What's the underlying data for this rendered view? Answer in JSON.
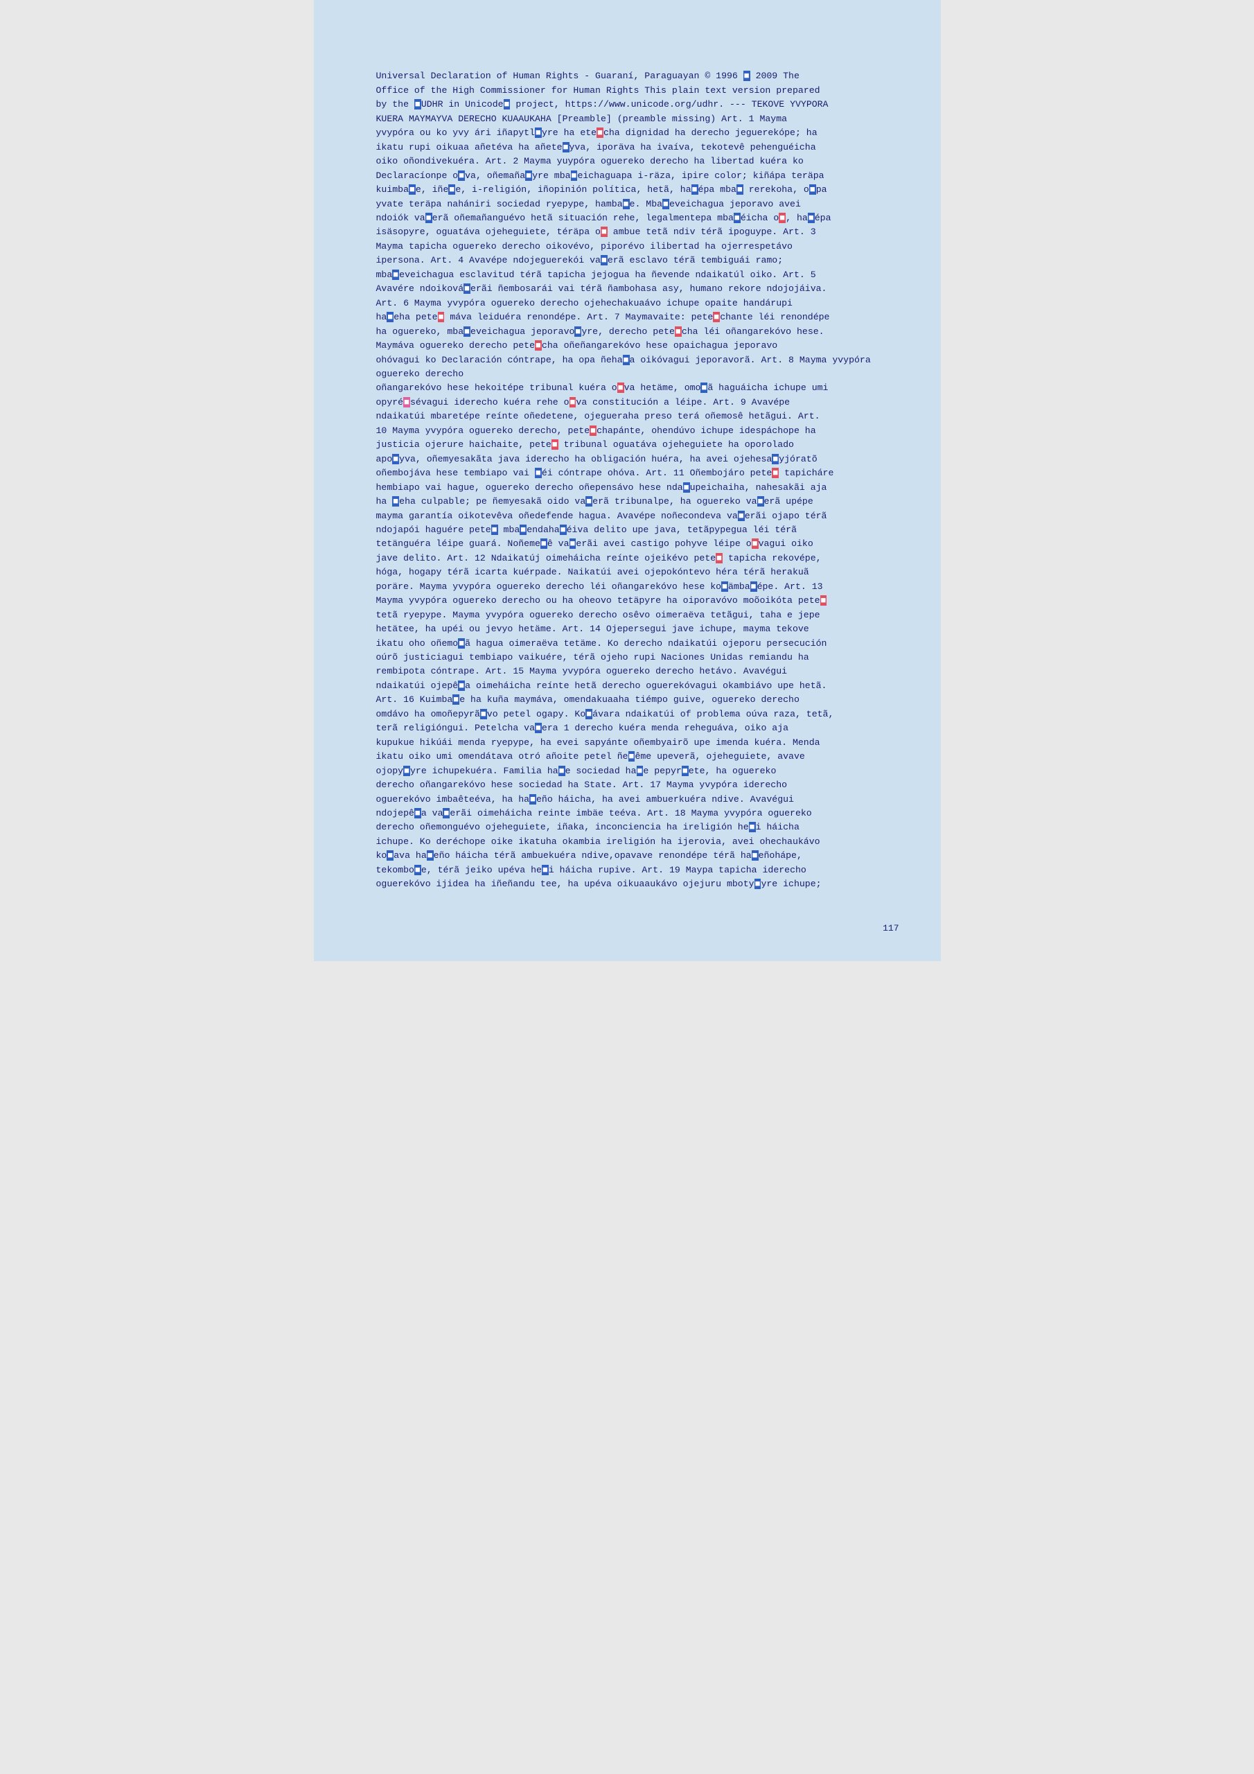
{
  "page": {
    "number": "117",
    "background_color": "#cce0f0",
    "text_color": "#1a1a6e"
  },
  "content": {
    "title": "Universal Declaration of Human Rights - Guaraní, Paraguayan © 1996 ■ 2009 The Office of the High Commissioner for Human Rights This plain text version prepared by the ■UDHR in Unicode■ project, https://www.unicode.org/udhr. --- TEKOVE YVYPORA KUERA MAYMAYVA DERECHO KUAAUKAHA [Preamble] (preamble missing) Art. 1 Mayma yvypóra ou ko yvy ári iñapytl■yre ha ete■cha dignidad ha derecho jeguerekópe; ha ikatu rupi oikuaa añetéva ha añete■yva, iporäva ha ivaíva, tekotevê pehenguéicha oiko oñondivekuéra. Art. 2 Mayma yuypóra oguereko derecho ha libertad kuéra ko Declaracíonpe o■va, oñemaña■yre mba■eichaguapa i-räza, ipire color; kiñápa teräpa kuimba■e, iñe■e, i-religión, iñopinión política, hetã, ha■épa mba■ rerekoha, o■pa yvate teräpa nahániri sociedad ryepype, hamba■e. Mba■eveichagua jeporavo avei ndoiók va■erã oñemañanguévo hetã situación rehe, legalmentepa mba■éicha o■, ha■épa isäsopyre, oguatáva ojeheguiete, téräpa o■ ambue tetã ndiv térã ipoguype. Art. 3 Mayma tapicha oguereko derecho oikovévo, piporévo ilibertad ha ojerrespetávo ipersona. Art. 4 Avavépe ndojeguerekói va■erã esclavo térã tembiguái ramo; mba■eveichagua esclavitud térã tapicha jejogua ha ñevende ndaikatúl oiko. Art. 5 Avavére ndoiková■erãi ñembosarái vai térã ñambohasa asy, humano rekore ndojojáiva. Art. 6 Mayma yvypóra oguereko derecho ojehechakuaávo ichupe opaite handárupi ha■eha pete■ máva leiduéra renondépe. Art. 7 Maymavaite: pete■chante léi renondépe ha oguereko, mba■eveichagua jeporavo■yre, derecho pete■cha léi oñangarekóvo hese. Maymáva oguereko derecho pete■cha oñeñangarekóvo hese opaichagua jeporavo ohóvagui ko Declaración cóntrape, ha opa ñeha■a oikóvagui jeporavorã. Art. 8 Mayma yvypóra oguereko derecho oñangarekóvo hese hekoitépe tribunal kuéra o■va hetäme, omo■ã haguáicha ichupe umi opyré■sévagui iderecho kuéra rehe o■va constitución a léipe. Art. 9 Avavépe ndaikatúi mbaretépe reínte oñedetene, ojegueraha preso terá oñemosê hetãgui. Art. 10 Mayma yvypóra oguereko derecho, pete■chapánte, ohendúvo ichupe idespáchope ha justicia ojerure haichaite, pete■ tribunal oguatáva ojeheguiete ha oporolado apo■yva, oñemyesakãta java iderecho ha obligación huéra, ha avei ojehesa■yjóratõ oñembojáva hese tembiapo vai ■éi cóntrape ohóva. Art. 11 Oñembojáro pete■ tapicháre hembiapo vai hague, oguereko derecho oñepensávo hese nda■upeichaiha, nahesakãi aja ha ■eha culpable; pe ñemyesakã oido va■erã tribunalpe, ha oguereko va■erã upépe mayma garantía oikotevêva oñedefende hagua. Avavépe noñecondeva va■erãi ojapo térã ndojapói haguére pete■ mba■endaha■éiva delito upe java, tetãpypegua léi térã tetänguéra léipe guará. Noñeme■ê va■erãi avei castigo pohyve léipe o■vagui oiko jave delito. Art. 12 Ndaikatúj oimeháicha reínte ojeikévo pete■ tapicha rekovépe, hóga, hogapy térã icarta kuérpade. Naikatúi avei ojepokóntevo héra térã herakuã poräre. Mayma yvypóra oguereko derecho léi oñangarekóvo hese ko■ämba■épe. Art. 13 Mayma yvypóra oguereko derecho ou ha oheovo tetäpyre ha oiporavóvo moõoikóta pete■ tetã ryepype. Mayma yvypóra oguereko derecho osêvo oimeraëva tetãgui, taha e jepe hetätee, ha upéi ou jevyo hetäme. Art. 14 Ojepersegui jave ichupe, mayma tekove ikatu oho oñemo■ã hagua oimeraëva tetäme. Ko derecho ndaikatúi ojeporu persecución oúrõ justiciagui tembiapo vaikuére, térã ojeho rupi Naciones Unidas remiandu ha rembipota cóntrape. Art. 15 Mayma yvypóra oguereko derecho hetávo. Avavégui ndaikatúi ojepê■a oimeháicha reínte hetã derecho oguerekóvagui okambiávo upe hetã. Art. 16 Kuimba■e ha kuña maymáva, omendakuaaha tiémpo guive, oguereko derecho omdávo ha omoñepyrã■vo petel ogapy. Ko■ávara ndaikatúi of problema oúva raza, tetã, terã religióngui. Petelcha va■era 1 derecho kuéra menda reheguáva, oiko aja kupukue hikúái menda ryepype, ha evei sapyánte oñembyairõ upe imenda kuéra. Menda ikatu oiko umi omendátava otró añoite petel ñe■ême upeverã, ojeheguiete, avave ojopy■yre ichupekuéra. Familia ha■e sociedad ha■e pepyr■ete, ha oguereko derecho oñangarekóvo hese sociedad ha State. Art. 17 Mayma yvypóra iderecho oguerekóvo imbaêteéva, ha ha■eño háicha, ha avei ambuerkuéra ndive. Avavégui ndojepê■a va■erãi oimeháicha reinte imbäe teéva. Art. 18 Mayma yvypóra oguereko derecho oñemonguévo ojeheguiete, iñaka, inconciencia ha ireligión he■i háicha ichupe. Ko deréchope oike ikatuha okambia ireligión ha ijerovia, avei ohechaukávo ko■ava ha■eño háicha térã ambuekuéra ndive,opavave renondépe térã ha■eñohápe, tekombo■e, térã jeiko upéva he■i háicha rupive. Art. 19 Maypa tapicha iderecho oguerekóvo ijidea ha iñeñandu tee, ha upéva oikuaaukávo ojejuru mboty■yre ichupe;"
  }
}
